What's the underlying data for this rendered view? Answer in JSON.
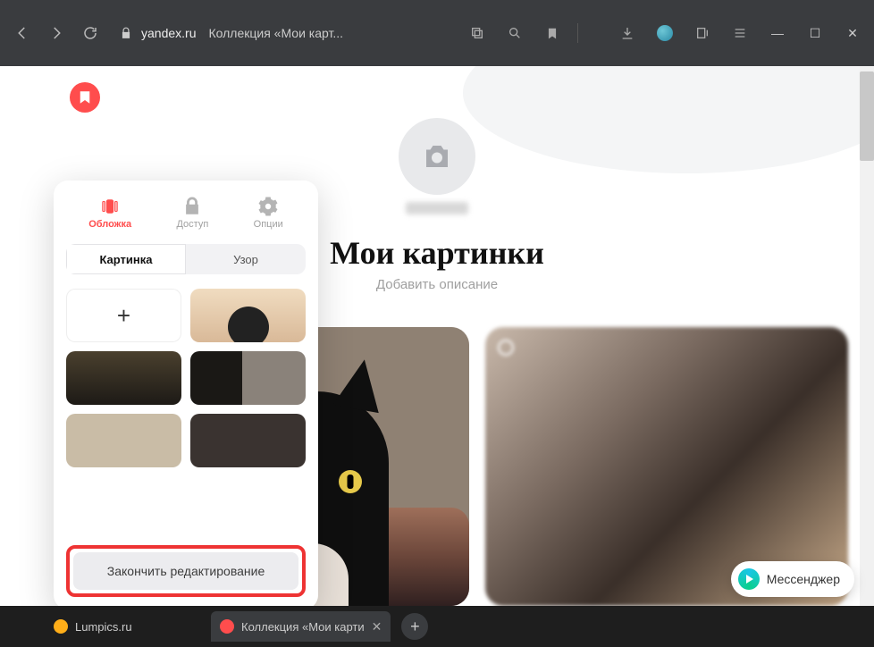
{
  "browser": {
    "domain": "yandex.ru",
    "title": "Коллекция «Мои карт..."
  },
  "page": {
    "heading": "Мои картинки",
    "add_description": "Добавить описание"
  },
  "panel": {
    "tabs": {
      "cover": "Обложка",
      "access": "Доступ",
      "options": "Опции"
    },
    "segment": {
      "picture": "Картинка",
      "pattern": "Узор"
    },
    "finish": "Закончить редактирование"
  },
  "messenger": {
    "label": "Мессенджер"
  },
  "taskbar": {
    "tab1": "Lumpics.ru",
    "tab2": "Коллекция «Мои карти"
  }
}
